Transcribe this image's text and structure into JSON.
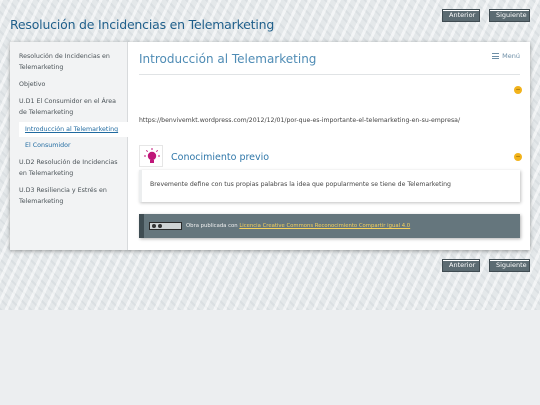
{
  "site": {
    "title": "Resolución de Incidencias en Telemarketing"
  },
  "nav": {
    "prev_label": "Anterior",
    "next_label": "Siguiente"
  },
  "sidebar": {
    "items": [
      {
        "label": "Resolución de Incidencias en Telemarketing"
      },
      {
        "label": "Objetivo"
      },
      {
        "label": "U.D1 El Consumidor en el Área de Telemarketing"
      },
      {
        "label": "Introducción al Telemarketing",
        "active": true
      },
      {
        "label": "El Consumidor"
      },
      {
        "label": "U.D2 Resolución de Incidencias en Telemarketing"
      },
      {
        "label": "U.D3 Resiliencia y Estrés en Telemarketing"
      }
    ]
  },
  "main": {
    "heading": "Introducción al Telemarketing",
    "menu_label": "Menú",
    "url_text": "https://benvivemkt.wordpress.com/2012/12/01/por-que-es-importante-el-telemarketing-en-su-empresa/",
    "box": {
      "title": "Conocimiento previo",
      "icon": "lightbulb-icon",
      "body": "Brevemente define con tus propias palabras la idea que popularmente se tiene de Telemarketing"
    },
    "license": {
      "prefix": "Obra publicada con",
      "link_text": "Licencia Creative Commons Reconocimiento Compartir igual 4.0",
      "badge": "cc-by-sa-badge"
    }
  },
  "colors": {
    "accent": "#2f77a9",
    "toggle": "#f2b31b",
    "button": "#5c6b72",
    "license_bar": "#65767d",
    "icon_magenta": "#c0177a"
  }
}
